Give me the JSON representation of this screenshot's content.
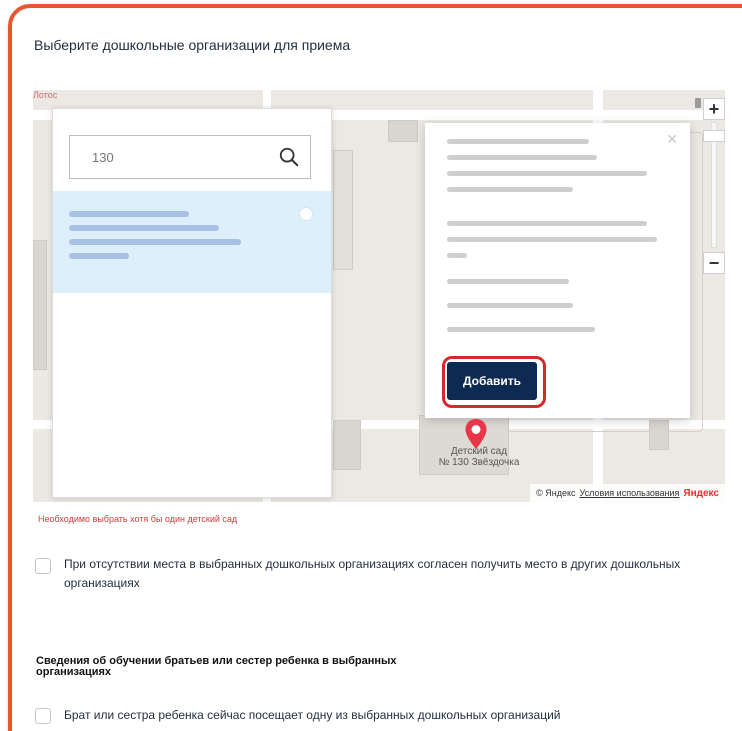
{
  "page_title": "Выберите дошкольные организации для приема",
  "map": {
    "label_lotos": "Лотос",
    "zoom_in": "+",
    "zoom_out": "−",
    "search_placeholder": "130",
    "selected_org_name": "",
    "popup": {
      "org_name": "",
      "address": "",
      "email": "",
      "phone": "",
      "site": "",
      "add_label": "Добавить"
    },
    "pin_label": "Детский сад\n№ 130 Звёздочка",
    "footer": {
      "copyright": "© Яндекс",
      "terms": "Условия использования",
      "brand": "Яндекс"
    }
  },
  "error_text": "Необходимо выбрать хотя бы один детский сад",
  "agree_checkbox_label": "При отсутствии места в выбранных дошкольных организациях согласен получить место в других дошкольных организациях",
  "siblings": {
    "heading": "Сведения об обучении братьев или сестер ребенка в выбранных организациях",
    "checkbox_label": "Брат или сестра ребенка сейчас посещает одну из выбранных дошкольных организаций"
  },
  "colors": {
    "frame": "#e8552f",
    "add_button": "#0d2a52",
    "highlight": "#d62a2a",
    "error": "#d13b3b",
    "selected_row": "#ddeffb"
  }
}
